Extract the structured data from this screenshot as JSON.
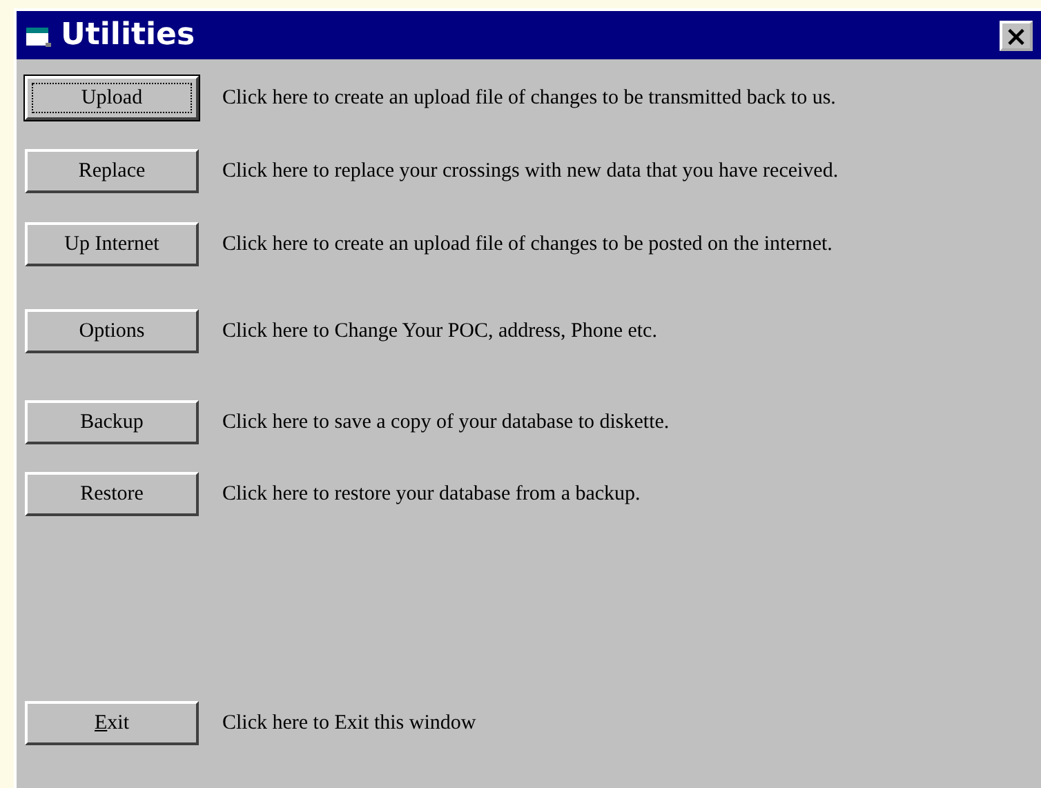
{
  "window": {
    "title": "Utilities",
    "close": "×"
  },
  "actions": [
    {
      "button": "Upload",
      "focused": true,
      "description": "Click here to create an upload file of changes to be transmitted back to us."
    },
    {
      "button": "Replace",
      "focused": false,
      "description": "Click here to replace your crossings with new data that you have received."
    },
    {
      "button": "Up Internet",
      "focused": false,
      "description": "Click here to create an upload file of changes to be posted on the internet."
    },
    {
      "button": "Options",
      "focused": false,
      "description": "Click here to Change Your POC, address, Phone etc."
    },
    {
      "button": "Backup",
      "focused": false,
      "description": "Click here to save a copy of your database to diskette."
    },
    {
      "button": "Restore",
      "focused": false,
      "description": "Click here to restore your database from a backup."
    },
    {
      "button": "Exit",
      "focused": false,
      "first_letter_underlined": true,
      "description": "Click here to Exit this window"
    }
  ]
}
